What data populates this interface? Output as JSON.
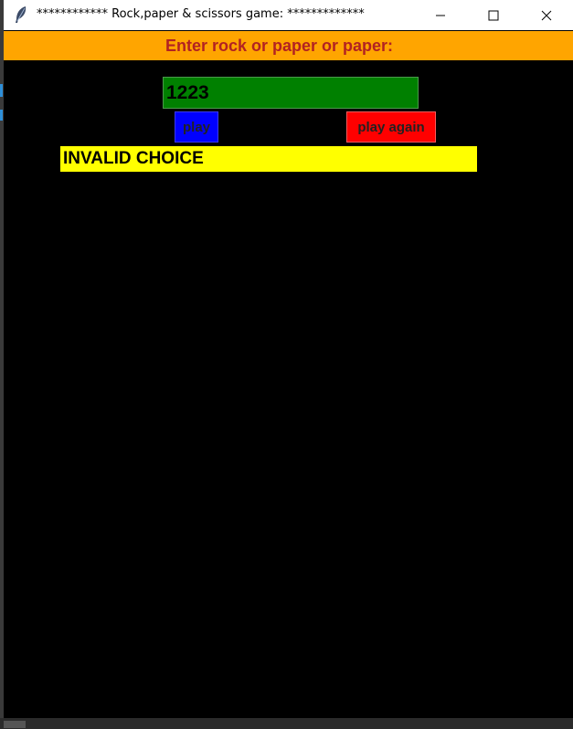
{
  "window": {
    "title": "************ Rock,paper & scissors game: *************",
    "controls": {
      "minimize_icon": "minimize-icon",
      "maximize_icon": "maximize-icon",
      "close_icon": "close-icon"
    }
  },
  "prompt": {
    "text": "Enter rock or paper or paper:",
    "background": "#ffa500",
    "color": "#b22222"
  },
  "input": {
    "value": "1223",
    "background": "#008000"
  },
  "buttons": {
    "play_label": "play",
    "play_color": "#0000ff",
    "play_again_label": "play again",
    "play_again_color": "#ff0000"
  },
  "result": {
    "text": "INVALID CHOICE",
    "background": "#ffff00"
  }
}
